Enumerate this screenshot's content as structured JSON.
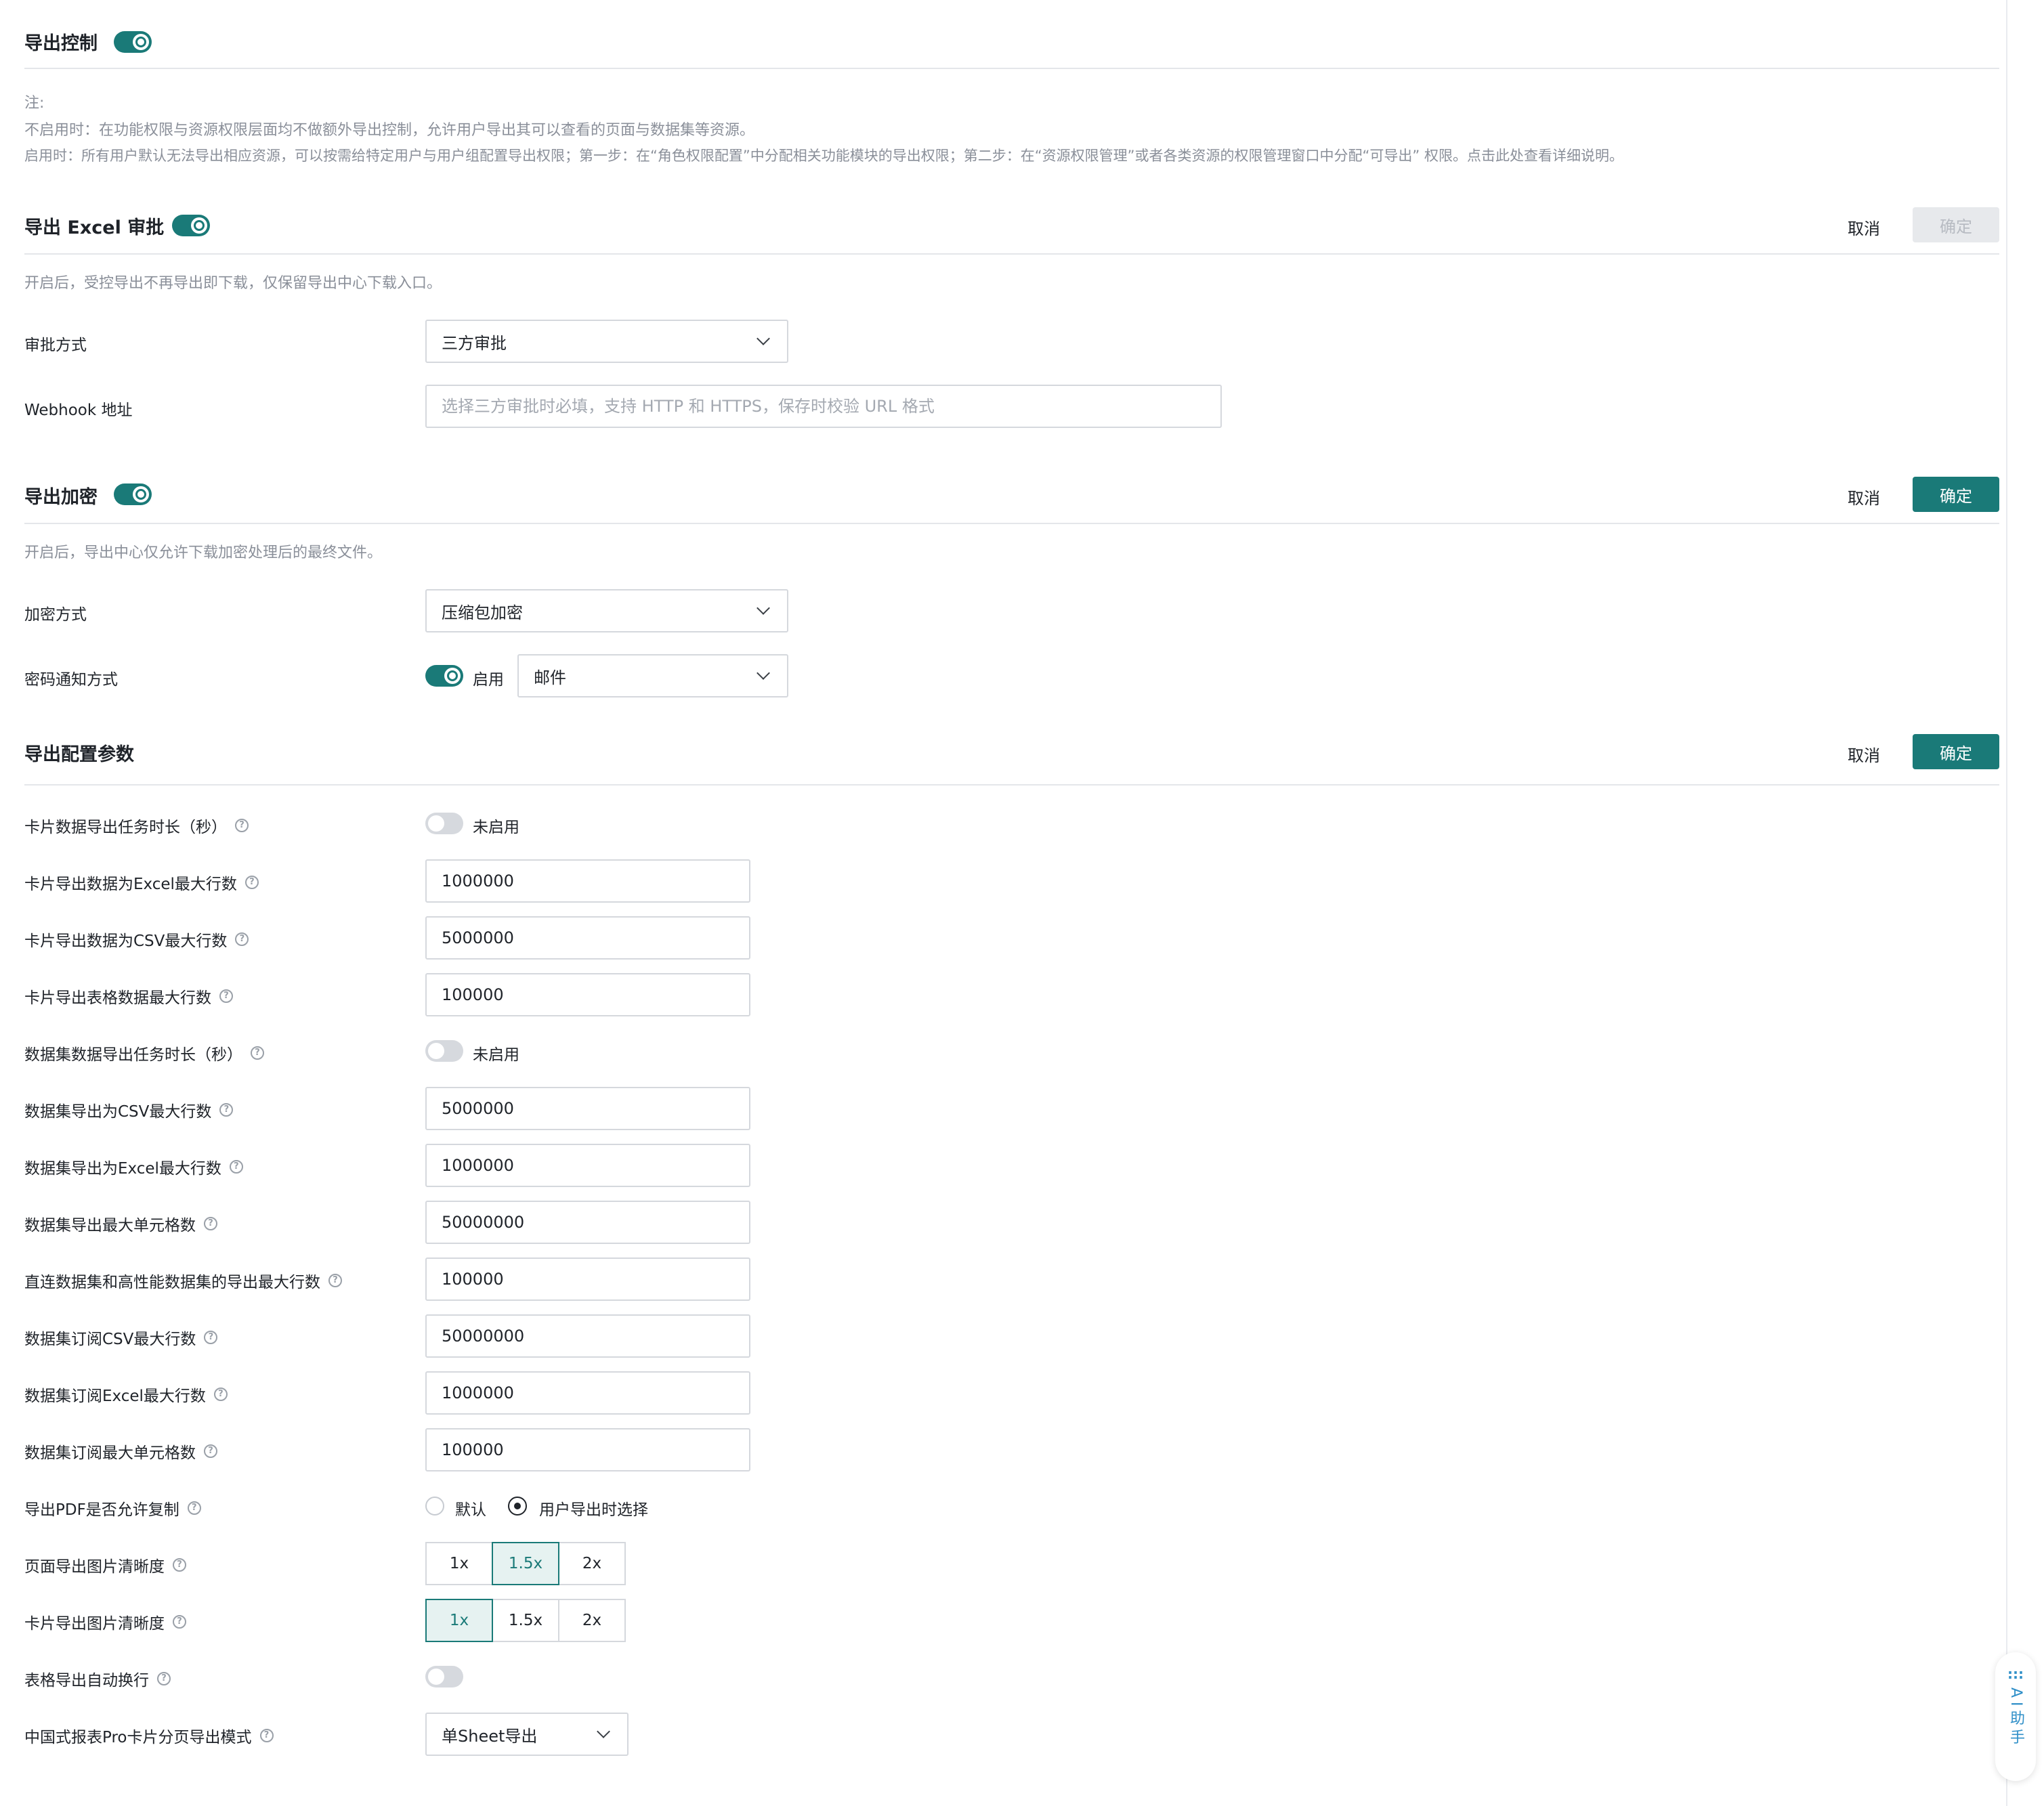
{
  "export_control": {
    "title": "导出控制",
    "enabled": true,
    "note_title": "注:",
    "note_line1": "不启用时：在功能权限与资源权限层面均不做额外导出控制，允许用户导出其可以查看的页面与数据集等资源。",
    "note_line2": "启用时：所有用户默认无法导出相应资源，可以按需给特定用户与用户组配置导出权限；第一步：在“角色权限配置”中分配相关功能模块的导出权限；第二步：在“资源权限管理”或者各类资源的权限管理窗口中分配“可导出” 权限。点击此处查看详细说明。"
  },
  "excel_approval": {
    "title": "导出 Excel 审批",
    "enabled": true,
    "cancel_label": "取消",
    "ok_label": "确定",
    "description": "开启后，受控导出不再导出即下载，仅保留导出中心下载入口。",
    "approval_method_label": "审批方式",
    "approval_method_value": "三方审批",
    "webhook_label": "Webhook 地址",
    "webhook_placeholder": "选择三方审批时必填，支持 HTTP 和 HTTPS，保存时校验 URL 格式",
    "webhook_value": ""
  },
  "export_encryption": {
    "title": "导出加密",
    "enabled": true,
    "cancel_label": "取消",
    "ok_label": "确定",
    "description": "开启后，导出中心仅允许下载加密处理后的最终文件。",
    "encryption_method_label": "加密方式",
    "encryption_method_value": "压缩包加密",
    "password_notify_label": "密码通知方式",
    "password_notify_toggle_text": "启用",
    "password_notify_value": "邮件"
  },
  "export_params": {
    "title": "导出配置参数",
    "cancel_label": "取消",
    "ok_label": "确定",
    "card_task_duration_label": "卡片数据导出任务时长（秒）",
    "card_task_duration_state": "未启用",
    "card_excel_max_rows_label": "卡片导出数据为Excel最大行数",
    "card_excel_max_rows": "1000000",
    "card_csv_max_rows_label": "卡片导出数据为CSV最大行数",
    "card_csv_max_rows": "5000000",
    "card_table_max_rows_label": "卡片导出表格数据最大行数",
    "card_table_max_rows": "100000",
    "dataset_task_duration_label": "数据集数据导出任务时长（秒）",
    "dataset_task_duration_state": "未启用",
    "dataset_csv_max_rows_label": "数据集导出为CSV最大行数",
    "dataset_csv_max_rows": "5000000",
    "dataset_excel_max_rows_label": "数据集导出为Excel最大行数",
    "dataset_excel_max_rows": "1000000",
    "dataset_max_cells_label": "数据集导出最大单元格数",
    "dataset_max_cells": "50000000",
    "direct_dataset_max_rows_label": "直连数据集和高性能数据集的导出最大行数",
    "direct_dataset_max_rows": "100000",
    "subscribe_csv_max_rows_label": "数据集订阅CSV最大行数",
    "subscribe_csv_max_rows": "50000000",
    "subscribe_excel_max_rows_label": "数据集订阅Excel最大行数",
    "subscribe_excel_max_rows": "1000000",
    "subscribe_max_cells_label": "数据集订阅最大单元格数",
    "subscribe_max_cells": "100000",
    "pdf_copy_label": "导出PDF是否允许复制",
    "pdf_copy_options": [
      "默认",
      "用户导出时选择"
    ],
    "pdf_copy_selected": "用户导出时选择",
    "page_image_resolution_label": "页面导出图片清晰度",
    "page_image_resolution_options": [
      "1x",
      "1.5x",
      "2x"
    ],
    "page_image_resolution_selected": "1.5x",
    "card_image_resolution_label": "卡片导出图片清晰度",
    "card_image_resolution_options": [
      "1x",
      "1.5x",
      "2x"
    ],
    "card_image_resolution_selected": "1x",
    "table_auto_wrap_label": "表格导出自动换行",
    "table_auto_wrap_enabled": false,
    "pro_card_paging_label": "中国式报表Pro卡片分页导出模式",
    "pro_card_paging_value": "单Sheet导出"
  },
  "ai_assistant": {
    "icon": "grid-dots-icon",
    "label": "AI助手"
  },
  "colors": {
    "accent": "#1a7a78",
    "text": "#1f2329",
    "muted": "#8a8f99",
    "border": "#d5d8dd"
  }
}
